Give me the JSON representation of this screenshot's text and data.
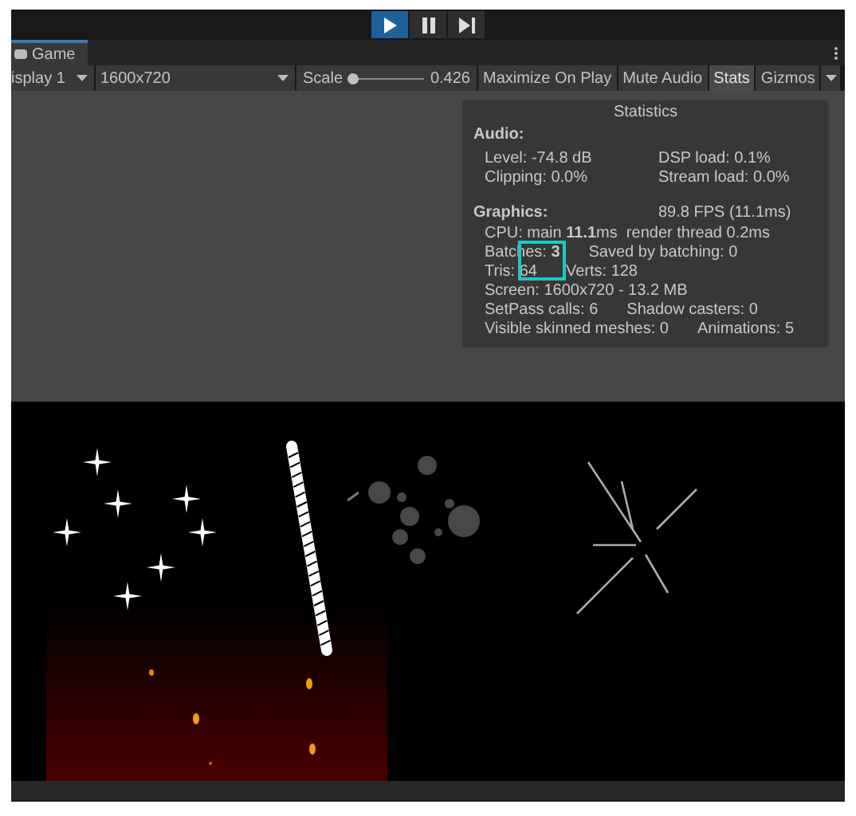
{
  "play_controls": [
    {
      "kind": "play",
      "selected": true
    },
    {
      "kind": "pause",
      "selected": false
    },
    {
      "kind": "step",
      "selected": false
    }
  ],
  "tab": {
    "title": "Game"
  },
  "toolbar": {
    "display": "isplay 1",
    "resolution": "1600x720",
    "scale_label": "Scale",
    "scale": {
      "level": 0.04
    },
    "scale_value": "0.426",
    "toggles": [
      {
        "label": "Maximize On Play",
        "on": false
      },
      {
        "label": "Mute Audio",
        "on": false
      },
      {
        "label": "Stats",
        "on": true
      },
      {
        "label": "Gizmos",
        "on": false
      }
    ]
  },
  "statistics": {
    "title": "Statistics",
    "sections": [
      {
        "heading": "Audio:",
        "rows": [
          {
            "left": "Level: -74.8 dB",
            "right": "DSP load: 0.1%"
          },
          {
            "left": "Clipping: 0.0%",
            "right": "Stream load: 0.0%"
          }
        ]
      },
      {
        "heading": "Graphics:",
        "heading_right": "89.8 FPS (11.1ms)",
        "rows": [
          {
            "left": "CPU: main **11.1**ms  render thread 0.2ms"
          },
          {
            "left": "Batches: **3**",
            "right": "Saved by batching: 0"
          },
          {
            "left": "Tris: 64",
            "right": "Verts: 128"
          },
          {
            "left": "Screen: 1600x720 - 13.2 MB"
          },
          {
            "left": "SetPass calls: 6",
            "right": "Shadow casters: 0"
          },
          {
            "left": "Visible skinned meshes: 0",
            "right": "Animations: 5"
          }
        ]
      }
    ]
  }
}
